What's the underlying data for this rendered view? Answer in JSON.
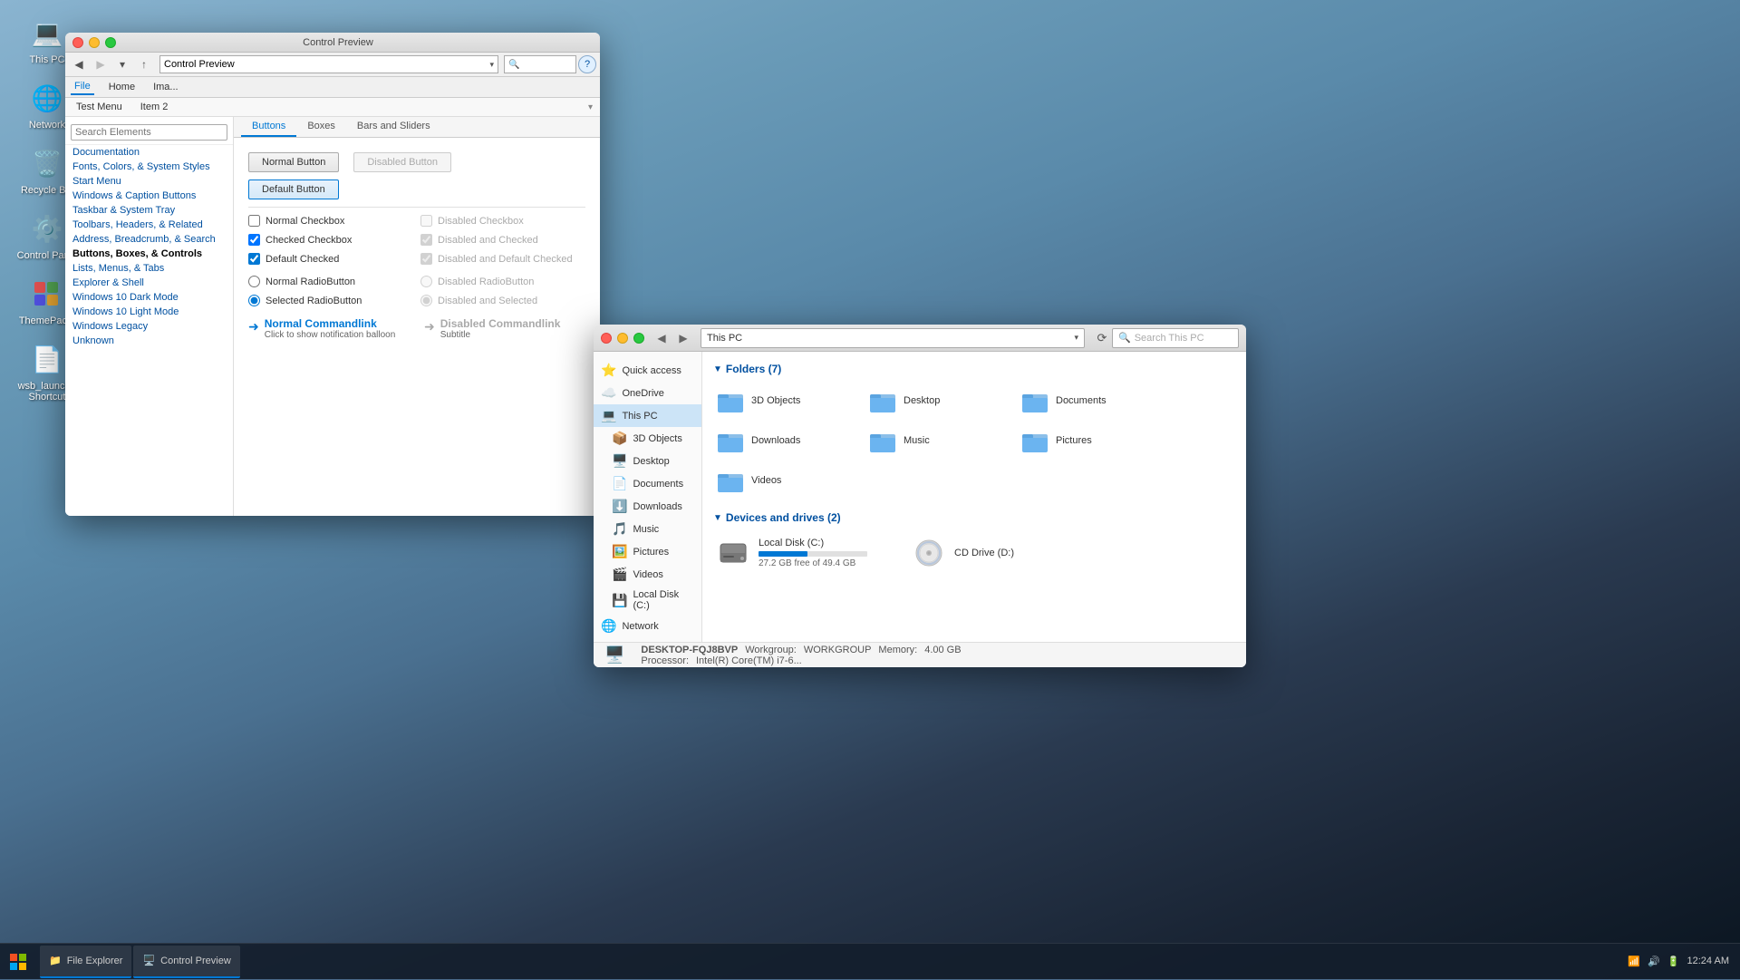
{
  "desktop": {
    "bg_gradient": "macOS Big Sur landscape",
    "icons": [
      {
        "id": "this-pc",
        "label": "This PC",
        "icon": "💻"
      },
      {
        "id": "network",
        "label": "Network",
        "icon": "🌐"
      },
      {
        "id": "recycle-bin",
        "label": "Recycle Bin",
        "icon": "🗑️"
      },
      {
        "id": "control-panel",
        "label": "Control Panel",
        "icon": "⚙️"
      },
      {
        "id": "themepac",
        "label": "ThemePac...",
        "icon": "🎨"
      },
      {
        "id": "wsb-launch",
        "label": "wsb_launch - Shortcut",
        "icon": "📄"
      }
    ]
  },
  "taskbar": {
    "items": [
      {
        "id": "file-explorer",
        "label": "File Explorer",
        "active": true,
        "icon": "📁"
      },
      {
        "id": "control-preview",
        "label": "Control Preview",
        "active": true,
        "icon": "🖥️"
      }
    ],
    "tray": {
      "time": "12:24 AM",
      "icons": [
        "network",
        "volume",
        "battery"
      ]
    }
  },
  "control_preview": {
    "title": "Control Preview",
    "menu_items": [
      "Test Menu",
      "Item 2"
    ],
    "tabs": [
      "Buttons",
      "Boxes",
      "Bars and Sliders"
    ],
    "active_tab": "Buttons",
    "sidebar_search_placeholder": "Search Elements",
    "sidebar_items": [
      "Documentation",
      "Fonts, Colors, & System Styles",
      "Start Menu",
      "Windows & Caption Buttons",
      "Taskbar & System Tray",
      "Toolbars, Headers, & Related",
      "Address, Breadcrumb, & Search",
      "Buttons, Boxes, & Controls",
      "Lists, Menus, & Tabs",
      "Explorer & Shell",
      "Windows 10 Dark Mode",
      "Windows 10 Light Mode",
      "Windows Legacy",
      "Unknown"
    ],
    "buttons": {
      "normal": "Normal Button",
      "disabled": "Disabled Button",
      "default": "Default Button"
    },
    "checkboxes": [
      {
        "label": "Normal Checkbox",
        "checked": false,
        "disabled": false
      },
      {
        "label": "Disabled Checkbox",
        "checked": false,
        "disabled": true
      },
      {
        "label": "Checked Checkbox",
        "checked": true,
        "disabled": false
      },
      {
        "label": "Disabled and Checked",
        "checked": true,
        "disabled": true
      },
      {
        "label": "Default Checked",
        "checked": true,
        "disabled": false,
        "default": true
      },
      {
        "label": "Disabled and Default Checked",
        "checked": true,
        "disabled": true,
        "default": true
      }
    ],
    "radios": [
      {
        "label": "Normal RadioButton",
        "selected": false,
        "disabled": false
      },
      {
        "label": "Disabled RadioButton",
        "selected": false,
        "disabled": true
      },
      {
        "label": "Selected RadioButton",
        "selected": true,
        "disabled": false
      },
      {
        "label": "Disabled and Selected",
        "selected": true,
        "disabled": true
      }
    ],
    "commandlinks": [
      {
        "title": "Normal Commandlink",
        "subtitle": "Click to show notification balloon",
        "disabled": false
      },
      {
        "title": "Disabled Commandlink",
        "subtitle": "Subtitle",
        "disabled": true
      }
    ]
  },
  "file_explorer": {
    "title": "This PC",
    "address": "This PC",
    "search_placeholder": "Search This PC",
    "nav_items": [
      {
        "label": "Quick access",
        "icon": "⭐",
        "active": false
      },
      {
        "label": "OneDrive",
        "icon": "☁️",
        "active": false
      },
      {
        "label": "This PC",
        "icon": "💻",
        "active": true
      },
      {
        "label": "3D Objects",
        "icon": "📦",
        "active": false
      },
      {
        "label": "Desktop",
        "icon": "🖥️",
        "active": false
      },
      {
        "label": "Documents",
        "icon": "📄",
        "active": false
      },
      {
        "label": "Downloads",
        "icon": "⬇️",
        "active": false
      },
      {
        "label": "Music",
        "icon": "🎵",
        "active": false
      },
      {
        "label": "Pictures",
        "icon": "🖼️",
        "active": false
      },
      {
        "label": "Videos",
        "icon": "🎬",
        "active": false
      },
      {
        "label": "Local Disk (C:)",
        "icon": "💾",
        "active": false
      },
      {
        "label": "Network",
        "icon": "🌐",
        "active": false
      }
    ],
    "folders_header": "Folders (7)",
    "folders": [
      {
        "name": "3D Objects",
        "color": "#5ba4e0"
      },
      {
        "name": "Desktop",
        "color": "#5ba4e0"
      },
      {
        "name": "Documents",
        "color": "#5ba4e0"
      },
      {
        "name": "Downloads",
        "color": "#5ba4e0"
      },
      {
        "name": "Music",
        "color": "#5ba4e0"
      },
      {
        "name": "Pictures",
        "color": "#5ba4e0"
      },
      {
        "name": "Videos",
        "color": "#5ba4e0"
      }
    ],
    "devices_header": "Devices and drives (2)",
    "drives": [
      {
        "name": "Local Disk (C:)",
        "free": "27.2 GB free of 49.4 GB",
        "used_pct": 45,
        "type": "hdd"
      },
      {
        "name": "CD Drive (D:)",
        "free": "",
        "used_pct": 0,
        "type": "cd"
      }
    ],
    "status": {
      "computer_name": "DESKTOP-FQJ8BVP",
      "workgroup_label": "Workgroup:",
      "workgroup": "WORKGROUP",
      "memory_label": "Memory:",
      "memory": "4.00 GB",
      "processor_label": "Processor:",
      "processor": "Intel(R) Core(TM) i7-6..."
    }
  }
}
